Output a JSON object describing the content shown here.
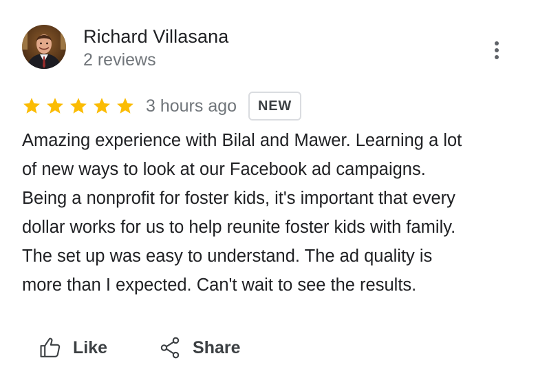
{
  "author": {
    "name": "Richard Villasana",
    "meta": "2 reviews"
  },
  "rating": {
    "stars": 5,
    "max_stars": 5,
    "star_color": "#fbbc04",
    "time": "3 hours ago",
    "badge": "NEW"
  },
  "review": {
    "text": "Amazing experience with Bilal and Mawer. Learning a lot\nof new ways to look at our Facebook ad campaigns.\nBeing a nonprofit for foster kids, it's important that every\ndollar works for us to help reunite foster kids with family.\nThe set up was easy to understand. The ad quality is\nmore than I expected. Can't wait to see the results."
  },
  "actions": {
    "like_label": "Like",
    "share_label": "Share"
  },
  "icons": {
    "more": "more-vert-icon",
    "like": "thumb-up-icon",
    "share": "share-icon"
  },
  "colors": {
    "text_primary": "#202124",
    "text_secondary": "#70757a",
    "badge_border": "#dadce0"
  }
}
